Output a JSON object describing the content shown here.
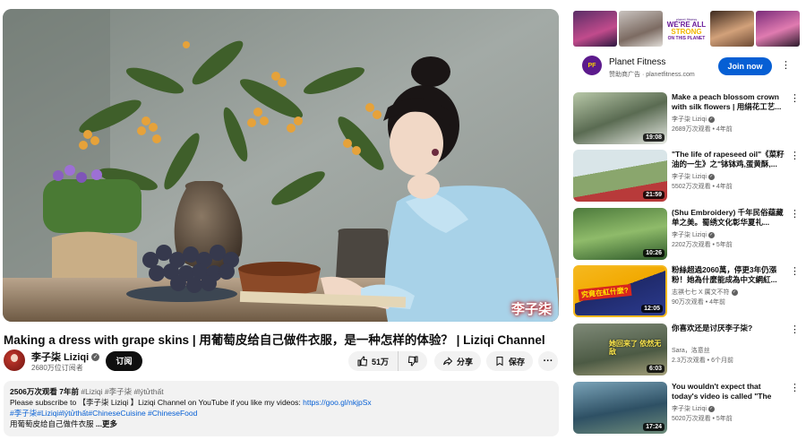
{
  "video": {
    "title": "Making a dress with grape skins | 用葡萄皮给自己做件衣服，是一种怎样的体验？ | Liziqi Channel",
    "watermark": "李子柒",
    "channel_name": "李子柒 Liziqi",
    "subscribers": "2680万位订阅者",
    "subscribe_label": "订阅",
    "likes": "51万",
    "share_label": "分享",
    "save_label": "保存",
    "more_label": "···"
  },
  "description": {
    "views": "2506万次观看",
    "age": "7年前",
    "top_tags": "#Liziqi #李子柒 #lýtửthất",
    "line1_prefix": "Please  subscribe to 【李子柒 Liziqi 】Liziqi Channel on YouTube if you like my videos: ",
    "line1_link": "https://goo.gl/nkjpSx",
    "line2_tags": "#李子柒#Liziqi#lýtửthất#ChineseCuisine #ChineseFood",
    "line3": "用葡萄皮给自己做件衣服",
    "more_label": "...更多"
  },
  "ad": {
    "banner_brand": "planet fitness",
    "banner_slogan_1": "WE'RE ALL",
    "banner_slogan_2": "STRONG",
    "banner_slogan_3": "ON THIS PLANET",
    "logo_text": "PF",
    "advertiser": "Planet Fitness",
    "sponsor_line": "赞助商广告 · planetfitness.com",
    "join_label": "Join now",
    "more_label": "⋮"
  },
  "recommendations": [
    {
      "title": "Make a peach blossom crown with silk flowers | 用绢花工艺...",
      "channel": "李子柒 Liziqi",
      "verified": true,
      "meta": "2689万次观看 • 4年前",
      "duration": "19:08"
    },
    {
      "title": "\"The life of rapeseed oil\"《菜籽油的一生》之\"钵钵鸡,蛋黄酥,...",
      "channel": "李子柒 Liziqi",
      "verified": true,
      "meta": "5502万次观看 • 4年前",
      "duration": "21:59"
    },
    {
      "title": "(Shu Embroidery) 千年民俗蕴藏单之美。蜀绣文化彰华夏礼...",
      "channel": "李子柒 Liziqi",
      "verified": true,
      "meta": "2202万次观看 • 5年前",
      "duration": "10:26"
    },
    {
      "title": "粉絲超過2060萬，停更3年仍漲粉！她為什麼能成為中文網紅...",
      "channel": "志褀七七 X 厲文不符",
      "verified": true,
      "meta": "90万次观看 • 4年前",
      "duration": "12:05",
      "badge": "究竟在紅什麼?"
    },
    {
      "title": "你喜欢还是讨厌李子柒?",
      "channel": "Sara，洛意丝",
      "verified": false,
      "meta": "2.3万次观看 • 6个月前",
      "duration": "6:03",
      "overlay": "她回来了 依然无敌"
    },
    {
      "title": "You wouldn't expect that today's video is called \"The Lif...",
      "channel": "李子柒 Liziqi",
      "verified": true,
      "meta": "5020万次观看 • 5年前",
      "duration": "17:24"
    }
  ],
  "colors": {
    "accent_blue": "#065fd4",
    "subscribe_black": "#0f0f0f",
    "secondary_text": "#606060",
    "pill_bg": "#f2f2f2"
  }
}
